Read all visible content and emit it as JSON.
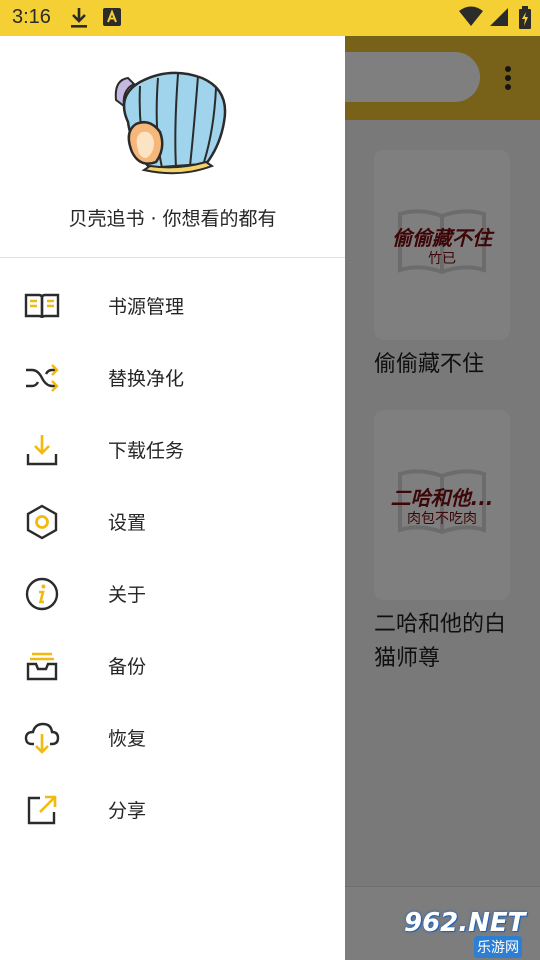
{
  "status_bar": {
    "time": "3:16",
    "icons": [
      "download-icon",
      "text-notification-icon",
      "wifi-icon",
      "signal-icon",
      "battery-charging-icon"
    ]
  },
  "background": {
    "toolbar_color": "#F1C232",
    "books": [
      {
        "cover_title": "偷偷藏不住",
        "cover_author": "竹已",
        "name": "偷偷藏不住"
      },
      {
        "cover_title": "二哈和他...",
        "cover_author": "肉包不吃肉",
        "name": "二哈和他的白猫师尊"
      }
    ]
  },
  "drawer": {
    "tagline": "贝壳追书 · 你想看的都有",
    "menu": [
      {
        "label": "书源管理",
        "icon": "book-source-icon"
      },
      {
        "label": "替换净化",
        "icon": "shuffle-icon"
      },
      {
        "label": "下载任务",
        "icon": "download-task-icon"
      },
      {
        "label": "设置",
        "icon": "settings-hexagon-icon"
      },
      {
        "label": "关于",
        "icon": "info-icon"
      },
      {
        "label": "备份",
        "icon": "backup-tray-icon"
      },
      {
        "label": "恢复",
        "icon": "cloud-download-icon"
      },
      {
        "label": "分享",
        "icon": "share-icon"
      }
    ],
    "accent_color": "#F2B90F"
  },
  "watermark": {
    "number": "962",
    "net": ".NET",
    "text": "乐游网"
  }
}
